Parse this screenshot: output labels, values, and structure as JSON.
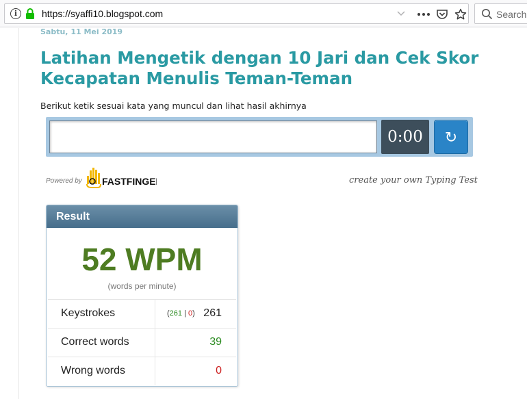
{
  "browser": {
    "url": "https://syaffi10.blogspot.com",
    "search_placeholder": "Search"
  },
  "post": {
    "date": "Sabtu, 11 Mei 2019",
    "title": "Latihan Mengetik dengan 10 Jari dan Cek Skor Kecapatan Menulis Teman-Teman",
    "intro": "Berikut ketik sesuai kata yang muncul dan lihat hasil akhirnya"
  },
  "typing_test": {
    "timer": "0:00",
    "reload_symbol": "↻",
    "powered_by": "Powered by",
    "logo_text": "FASTFINGERS",
    "create_link": "create your own Typing Test"
  },
  "result": {
    "header": "Result",
    "wpm": "52 WPM",
    "wpm_caption": "(words per minute)",
    "keystrokes": {
      "label": "Keystrokes",
      "open": "(",
      "correct": "261",
      "sep": "|",
      "wrong": "0",
      "close": ")",
      "total": "261"
    },
    "correct_words": {
      "label": "Correct words",
      "value": "39"
    },
    "wrong_words": {
      "label": "Wrong words",
      "value": "0"
    }
  },
  "colors": {
    "title": "#2a9aa3",
    "wpm": "#4e7c22",
    "correct": "#2a8a1f",
    "wrong": "#cc1f1f",
    "header": "#466e8b"
  }
}
